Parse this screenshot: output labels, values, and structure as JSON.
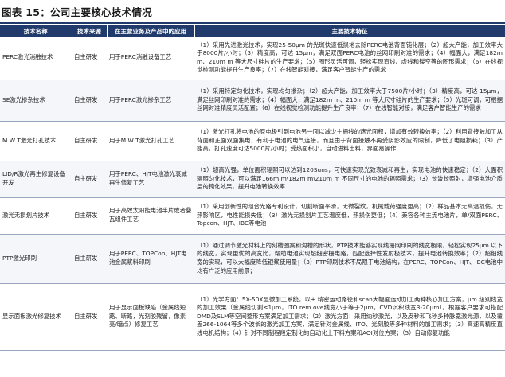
{
  "title": "图表 15：公司主要核心技术情况",
  "columns": [
    "技术名称",
    "技术来源",
    "在主营业务及产品中的应用",
    "主要技术特征"
  ],
  "rows": [
    {
      "name": "PERC激光消融技术",
      "source": "自主研发",
      "application": "用于PERC消融设备工艺",
      "features": "（1）采用先进激光技术，实现25-50μm 的光斑快速低损地去除PERC电池背面钝化层；（2）超大产能，加工效率大于8000片/小时；（3）精度高，可达 15μm，满足双面PERC电池的丝网印刷对准的需求；（4）幅面大，满足182m m、210m m 等大尺寸硅片的生产要求；（5）图形灵活可调，轻松实现直线、虚线和镂空等的图形需求；（6）在线视觉检测功能提升生产良率；（7）在线智能对接，满足客户智能生产的需求"
    },
    {
      "name": "SE激光掺杂技术",
      "source": "自主研发",
      "application": "用于PERC激光掺杂工艺",
      "features": "（1）采用特定匀化技术，实现均匀掺杂；（2）超大产能，加工效率大于7500片/小时；（3）精度高，可达 15μm，满足丝网印刷对准的需求；（4）幅面大，满足182m m、210m m 等大尺寸硅片的生产要求；（5）光斑可调，可根据丝网对准精度灵活配置；（6）在线视觉检测功能提升生产良率；（7）在线智能对接，满足客户智能生产的需求"
    },
    {
      "name": "M W T激光打孔技术",
      "source": "自主研发",
      "application": "用于M W T激光打孔工艺",
      "features": "（1）激光打孔将电池的原电极引到电池另一面以减少主栅线的遮光面积，增加有效转换效率；（2）利用背接触加工从背面和正面双面集电，有利于电池的电气连接，而且由于背面接触不再受阴影效应的限制，降低了电阻损耗；（3）产能高，打孔速度可达5000片/小时；受热面积小，自动进料出料，界面易操作"
    },
    {
      "name": "LID/R激光再生修复设备开发",
      "source": "自主研发",
      "application": "用于PERC、HJT电池激光衰减再生修复工艺",
      "features": "（1）超高光强，单位面积辐照可以达到120Suns，可快速实现光致衰减和再生，实现电池的快速稳定；（2）大面积辐照匀化技术，可以满足166m m\\182m m\\210m m 不同尺寸的电池的辐照需求；（3）长波长照射，增强电池介质层的钝化效果，提升电池转换效率"
    },
    {
      "name": "激光无损划片技术",
      "source": "自主研发",
      "application": "用于高效太阳能电池半片或者叠瓦组件工艺",
      "features": "（1）采用创新性的组合光路专利设计，切割断面平滑，无微裂纹，机械载荷强度更高；（2）样品基本无高温损伤，无热影响区，电性能损失低；（3）激光无损划片工艺温度低，热损伤更低；（4）兼容各种主流电池片，单/双面PERC、Topcon、HJT、IBC等电池"
    },
    {
      "name": "PTP激光印刷",
      "source": "自主研发",
      "application": "用于PERC、TOPCon、HJT电池金属浆料印刷",
      "features": "（1）通过调节激光材料上的刻槽图案和沟槽的形状，PTP技术能够实现线栅网印刷的线宽极限，轻松实现25μm 以下的线宽，实现更优的高宽比，帮助电池实现超细密栅电路，匹配选择性发射极技术，提升电池转换效率；（2）超细线宽的实现，可以大幅度降低银浆使用量；（3）PTP印刷技术不局限于电池结构，在PERC、TOPCon、HJT、IBC电池中均有广泛的应用前景；"
    },
    {
      "name": "显示面板激光修复技术",
      "source": "自主研发",
      "application": "用于显示面板缺陷（金属线短路、断路，光刻胶残留，像素亮/暗点）修复工艺",
      "features": "（1）光学方面：5X-50X显微加工系统，以± 精密运动路径和scan大幅面运动加工两种核心加工方案，μm 级别线宽的加工效果（金属线切割≤1μm，ITO rem ove线宽小于等于2μm，CVD沉积线宽3-20μm）。根据客户要求可搭配DMD及SLM等空间整形方案满足加工需求；（2）激光方面：采用纳秒激光，以及皮秒和飞秒多种脉宽激光源，以及覆盖266-1064等多个波长的激光加工方案，满足针对金属线、ITO、光刻胶等多种材料的加工需求；（3）高速高精度直线电机结构；（4）针对不同制程段定制化的自动化上下料方案和AOI对位方案；（5）自动修复功能"
    }
  ]
}
